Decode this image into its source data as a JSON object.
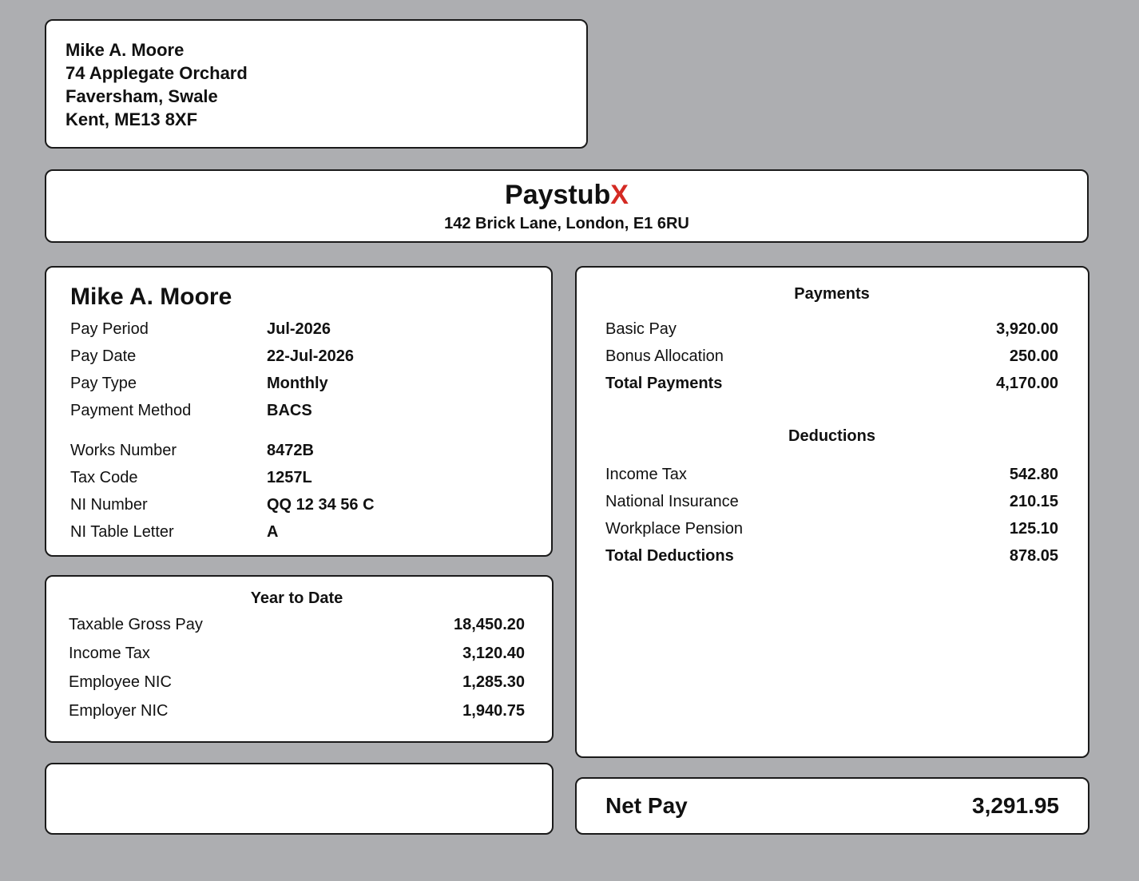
{
  "recipient": {
    "name": "Mike A. Moore",
    "address_line1": "74 Applegate Orchard",
    "address_line2": "Faversham, Swale",
    "address_line3": "Kent, ME13 8XF"
  },
  "company": {
    "name_main": "Paystub",
    "name_accent": "X",
    "accent_color": "#d42a23",
    "address": "142 Brick Lane, London, E1 6RU"
  },
  "employee": {
    "name": "Mike A. Moore",
    "details": [
      {
        "label": "Pay Period",
        "value": "Jul-2026"
      },
      {
        "label": "Pay Date",
        "value": "22-Jul-2026"
      },
      {
        "label": "Pay Type",
        "value": "Monthly"
      },
      {
        "label": "Payment Method",
        "value": "BACS"
      },
      {
        "label": "Works Number",
        "value": "8472B"
      },
      {
        "label": "Tax Code",
        "value": "1257L"
      },
      {
        "label": "NI Number",
        "value": "QQ 12 34 56 C"
      },
      {
        "label": "NI Table Letter",
        "value": "A"
      }
    ]
  },
  "ytd": {
    "title": "Year to Date",
    "rows": [
      {
        "label": "Taxable Gross Pay",
        "value": "18,450.20"
      },
      {
        "label": "Income Tax",
        "value": "3,120.40"
      },
      {
        "label": "Employee NIC",
        "value": "1,285.30"
      },
      {
        "label": "Employer NIC",
        "value": "1,940.75"
      }
    ]
  },
  "payments": {
    "title": "Payments",
    "rows": [
      {
        "label": "Basic Pay",
        "value": "3,920.00"
      },
      {
        "label": "Bonus Allocation",
        "value": "250.00"
      }
    ],
    "total": {
      "label": "Total Payments",
      "value": "4,170.00"
    }
  },
  "deductions": {
    "title": "Deductions",
    "rows": [
      {
        "label": "Income Tax",
        "value": "542.80"
      },
      {
        "label": "National Insurance",
        "value": "210.15"
      },
      {
        "label": "Workplace Pension",
        "value": "125.10"
      }
    ],
    "total": {
      "label": "Total Deductions",
      "value": "878.05"
    }
  },
  "net_pay": {
    "label": "Net Pay",
    "value": "3,291.95"
  }
}
